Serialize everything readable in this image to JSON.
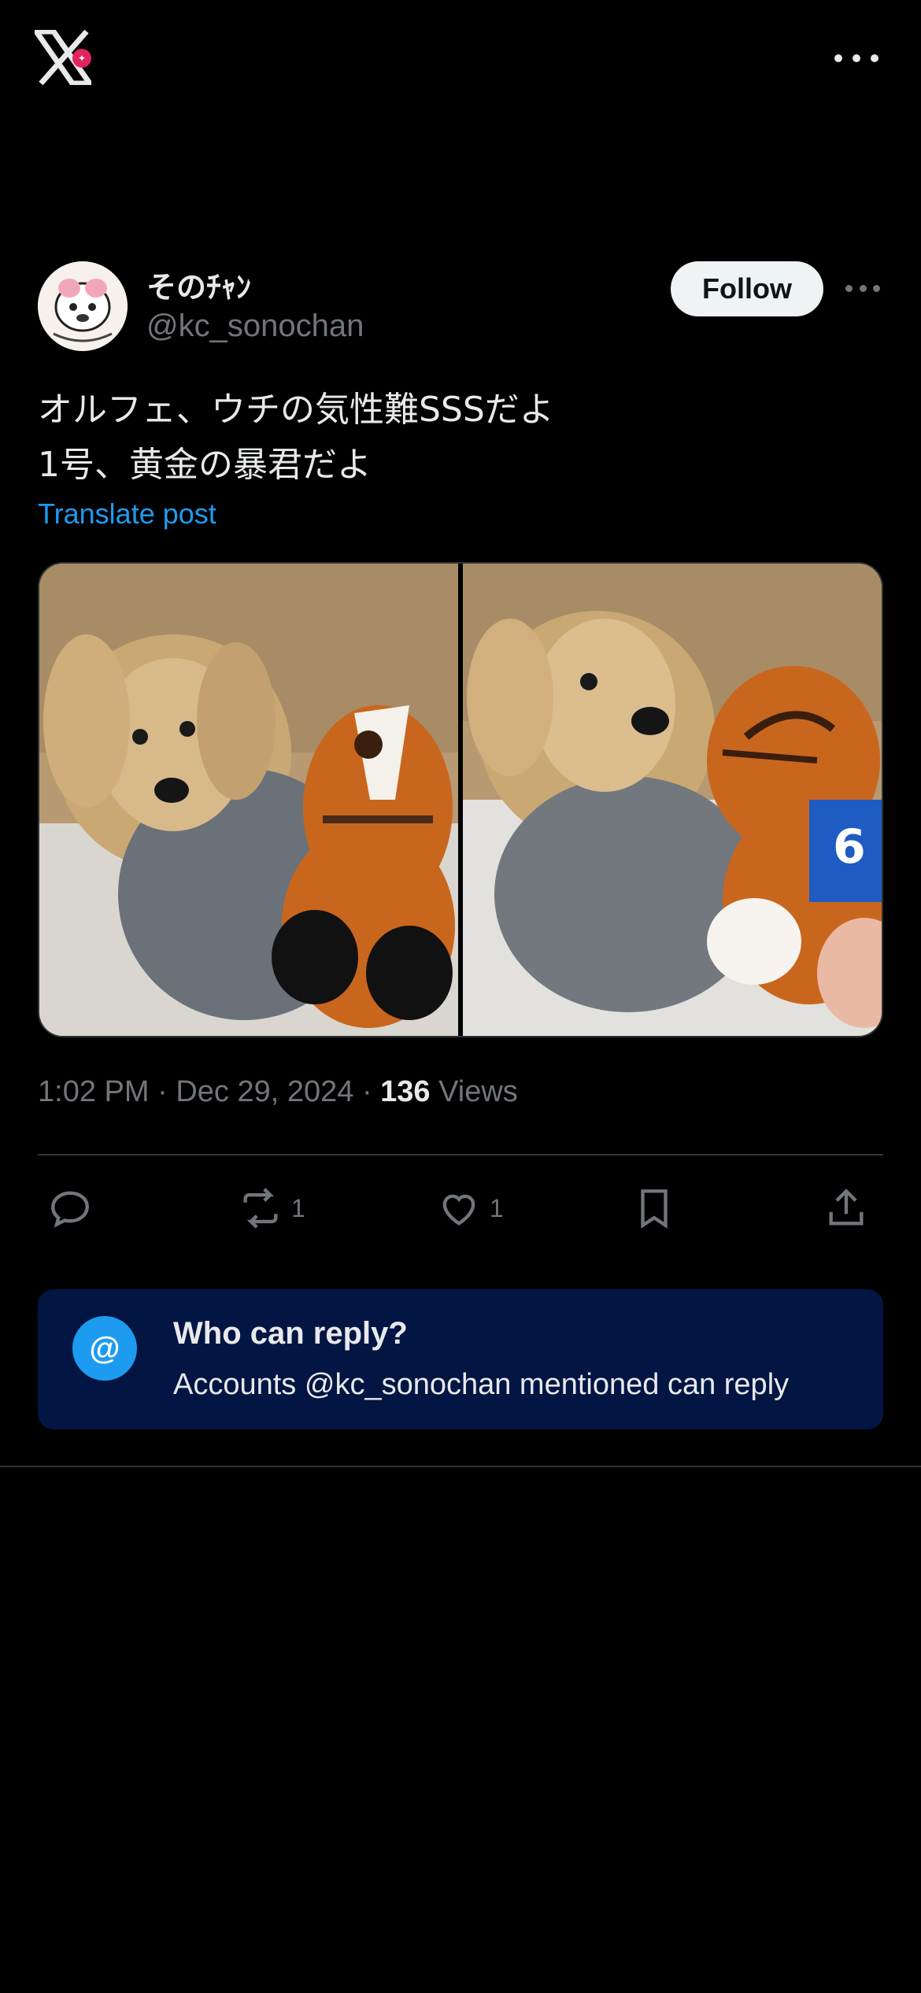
{
  "app": {
    "logo_icon": "x-logo-icon",
    "more_icon": "more-horizontal-icon"
  },
  "author": {
    "display_name": "そのﾁｬﾝ",
    "handle": "@kc_sonochan",
    "follow_label": "Follow"
  },
  "post": {
    "text_lines": [
      "オルフェ、ウチの気性難SSSだよ",
      "1号、黄金の暴君だよ"
    ],
    "translate_label": "Translate post",
    "media": [
      {
        "description_icon": "photo-dog-with-horse-plush-1"
      },
      {
        "description_icon": "photo-dog-with-horse-plush-2"
      }
    ],
    "time": "1:02 PM",
    "date": "Dec 29, 2024",
    "views_count": "136",
    "views_label": "Views",
    "separator": "·"
  },
  "actions": {
    "reply_count": "",
    "repost_count": "1",
    "like_count": "1"
  },
  "reply_restriction": {
    "title": "Who can reply?",
    "description": "Accounts @kc_sonochan mentioned can reply"
  },
  "colors": {
    "accent": "#1d9bf0",
    "background": "#000000",
    "reply_box": "#031543"
  }
}
